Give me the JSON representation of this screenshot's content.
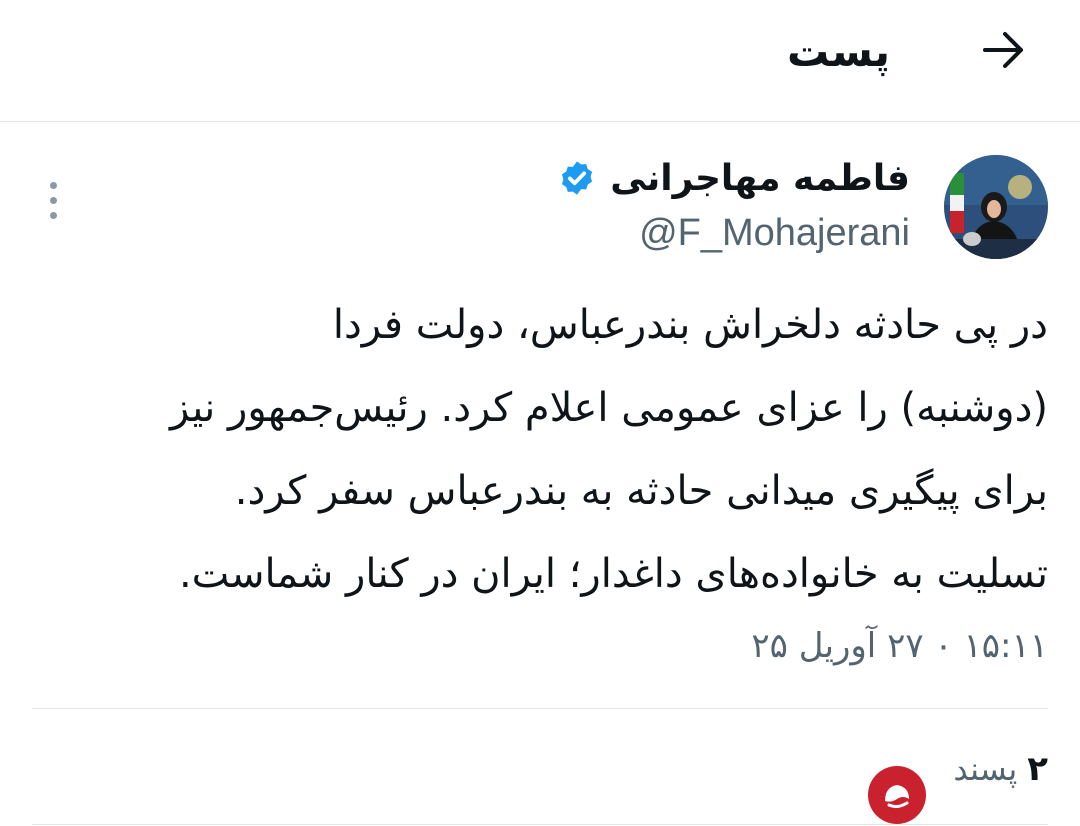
{
  "header": {
    "title": "پست",
    "back_icon": "arrow-right-icon"
  },
  "author": {
    "display_name": "فاطمه مهاجرانی",
    "handle": "@F_Mohajerani",
    "verified": true,
    "verified_color": "#1d9bf0",
    "avatar_icon": "profile-photo"
  },
  "tweet": {
    "lines": [
      "در پی حادثه دلخراش بندرعباس، دولت فردا",
      "(دوشنبه) را عزای عمومی اعلام کرد. رئیس‌جمهور نیز",
      "برای پیگیری میدانی حادثه به بندرعباس سفر کرد.",
      "تسلیت به خانواده‌های داغدار؛ ایران در کنار شماست."
    ],
    "timestamp": "۱۵:۱۱ ۰ ۲۷ آوریل ۲۵"
  },
  "engagement": {
    "likes_count": "۲",
    "likes_label": "پسند"
  },
  "colors": {
    "text": "#0f1419",
    "secondary": "#536471",
    "divider": "#e1e6ea",
    "watermark": "#c9222e"
  }
}
